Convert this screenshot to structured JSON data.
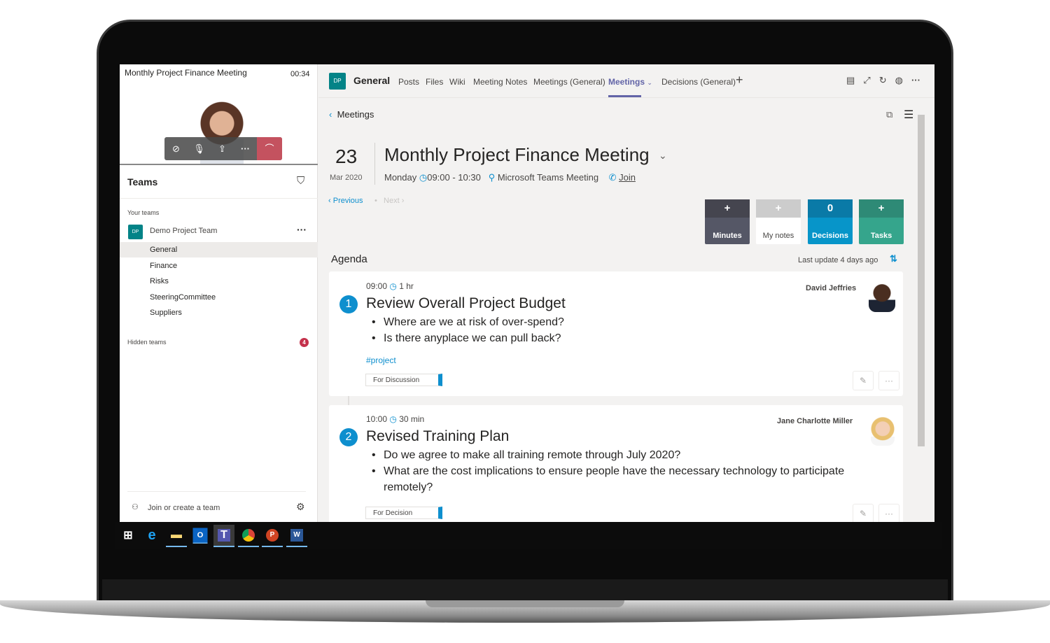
{
  "call": {
    "title": "Monthly Project Finance Meeting",
    "timer": "00:34"
  },
  "teams": {
    "heading": "Teams",
    "your_teams": "Your teams",
    "team_initials": "DP",
    "team_name": "Demo Project Team",
    "channels": [
      "General",
      "Finance",
      "Risks",
      "SteeringCommittee",
      "Suppliers"
    ],
    "selected_channel": "General",
    "hidden_teams": "Hidden teams",
    "hidden_count": "4",
    "join": "Join or create a team"
  },
  "header": {
    "initials": "DP",
    "channel": "General",
    "tabs": [
      "Posts",
      "Files",
      "Wiki",
      "Meeting Notes",
      "Meetings (General)",
      "Meetings",
      "Decisions (General)"
    ],
    "active_tab": "Meetings",
    "add": "+"
  },
  "meeting": {
    "back": "Meetings",
    "day": "23",
    "month": "Mar 2020",
    "title": "Monthly Project Finance Meeting",
    "weekday": "Monday",
    "time": "09:00 - 10:30",
    "location": "Microsoft Teams Meeting",
    "join": "Join",
    "previous": "Previous",
    "next": "Next"
  },
  "tiles": [
    {
      "top": "+",
      "label": "Minutes",
      "color": "#4f4f5b"
    },
    {
      "top": "+",
      "label": "My notes",
      "color": "#ffffff"
    },
    {
      "top": "0",
      "label": "Decisions",
      "color": "#0795c9"
    },
    {
      "top": "+",
      "label": "Tasks",
      "color": "#35a58c"
    }
  ],
  "agenda": {
    "heading": "Agenda",
    "last_update": "Last update 4 days ago",
    "sort_icon": "1\n2",
    "items": [
      {
        "num": "1",
        "time": "09:00",
        "duration": "1 hr",
        "title": "Review Overall Project Budget",
        "presenter": "David Jeffries",
        "bullets": [
          "Where are we at risk of over-spend?",
          "Is there anyplace we can pull back?"
        ],
        "hashtag": "#project",
        "tag": "For Discussion"
      },
      {
        "num": "2",
        "time": "10:00",
        "duration": "30 min",
        "title": "Revised Training Plan",
        "presenter": "Jane Charlotte Miller",
        "bullets": [
          "Do we agree to make all training remote through July 2020?",
          "What are the cost implications to ensure people have the necessary technology to participate remotely?"
        ],
        "tag": "For Decision"
      }
    ]
  },
  "colors": {
    "accent": "#6264a7",
    "blue": "#0e8fce",
    "teal": "#038387"
  },
  "taskbar": [
    "windows",
    "edge",
    "file-explorer",
    "outlook",
    "teams",
    "chrome",
    "powerpoint",
    "word"
  ]
}
